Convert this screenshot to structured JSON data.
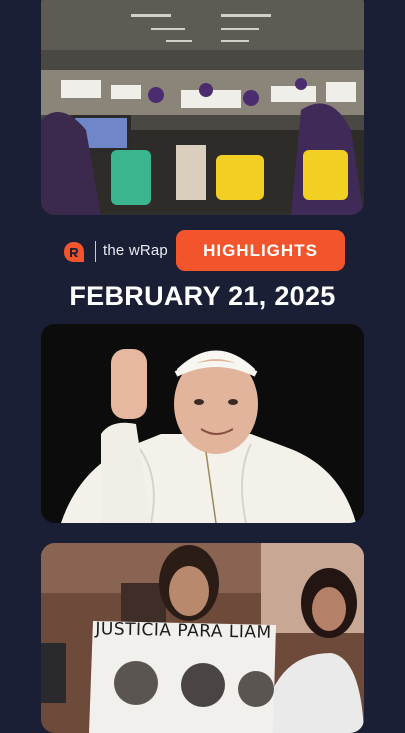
{
  "brand": {
    "logo_icon": "rappler-logo-icon",
    "show_name": "the wRap",
    "badge": "HIGHLIGHTS",
    "badge_color": "#f2552c"
  },
  "edition_date": "FEBRUARY 21, 2025",
  "stories": [
    {
      "image": "election-workers-sorting-ballots-photo"
    },
    {
      "image": "pope-waving-photo"
    },
    {
      "image": "protest-sign-photo",
      "sign_text": "JUSTICIA PARA LIAM"
    }
  ],
  "colors": {
    "background": "#1a1f35",
    "text": "#ffffff"
  }
}
